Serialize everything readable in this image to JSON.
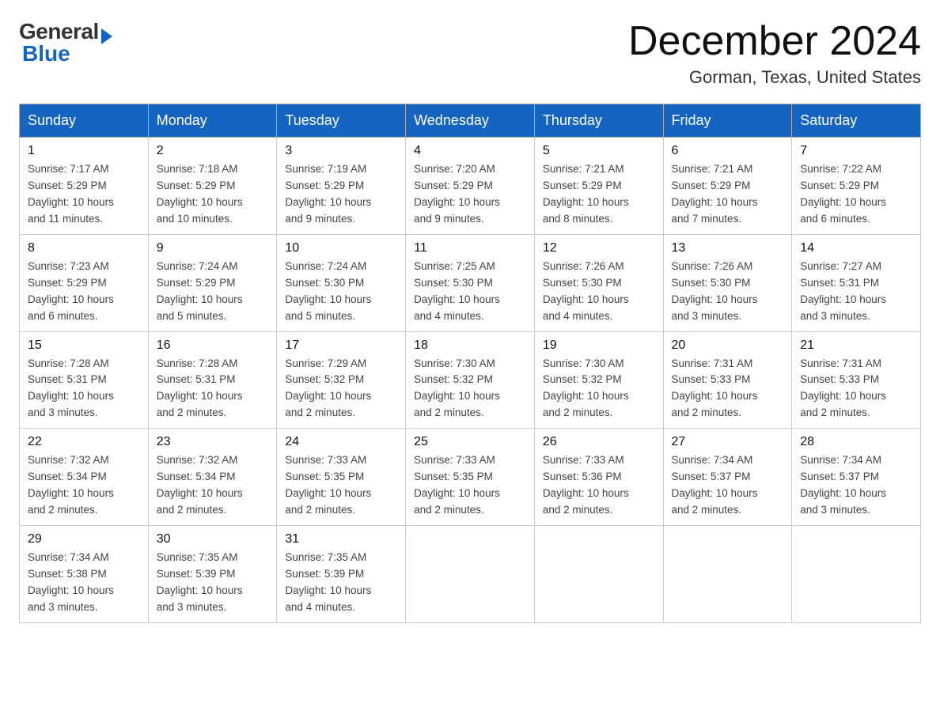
{
  "logo": {
    "general": "General",
    "blue": "Blue"
  },
  "title": {
    "month": "December 2024",
    "location": "Gorman, Texas, United States"
  },
  "headers": [
    "Sunday",
    "Monday",
    "Tuesday",
    "Wednesday",
    "Thursday",
    "Friday",
    "Saturday"
  ],
  "weeks": [
    [
      {
        "day": "1",
        "sunrise": "7:17 AM",
        "sunset": "5:29 PM",
        "daylight": "10 hours and 11 minutes."
      },
      {
        "day": "2",
        "sunrise": "7:18 AM",
        "sunset": "5:29 PM",
        "daylight": "10 hours and 10 minutes."
      },
      {
        "day": "3",
        "sunrise": "7:19 AM",
        "sunset": "5:29 PM",
        "daylight": "10 hours and 9 minutes."
      },
      {
        "day": "4",
        "sunrise": "7:20 AM",
        "sunset": "5:29 PM",
        "daylight": "10 hours and 9 minutes."
      },
      {
        "day": "5",
        "sunrise": "7:21 AM",
        "sunset": "5:29 PM",
        "daylight": "10 hours and 8 minutes."
      },
      {
        "day": "6",
        "sunrise": "7:21 AM",
        "sunset": "5:29 PM",
        "daylight": "10 hours and 7 minutes."
      },
      {
        "day": "7",
        "sunrise": "7:22 AM",
        "sunset": "5:29 PM",
        "daylight": "10 hours and 6 minutes."
      }
    ],
    [
      {
        "day": "8",
        "sunrise": "7:23 AM",
        "sunset": "5:29 PM",
        "daylight": "10 hours and 6 minutes."
      },
      {
        "day": "9",
        "sunrise": "7:24 AM",
        "sunset": "5:29 PM",
        "daylight": "10 hours and 5 minutes."
      },
      {
        "day": "10",
        "sunrise": "7:24 AM",
        "sunset": "5:30 PM",
        "daylight": "10 hours and 5 minutes."
      },
      {
        "day": "11",
        "sunrise": "7:25 AM",
        "sunset": "5:30 PM",
        "daylight": "10 hours and 4 minutes."
      },
      {
        "day": "12",
        "sunrise": "7:26 AM",
        "sunset": "5:30 PM",
        "daylight": "10 hours and 4 minutes."
      },
      {
        "day": "13",
        "sunrise": "7:26 AM",
        "sunset": "5:30 PM",
        "daylight": "10 hours and 3 minutes."
      },
      {
        "day": "14",
        "sunrise": "7:27 AM",
        "sunset": "5:31 PM",
        "daylight": "10 hours and 3 minutes."
      }
    ],
    [
      {
        "day": "15",
        "sunrise": "7:28 AM",
        "sunset": "5:31 PM",
        "daylight": "10 hours and 3 minutes."
      },
      {
        "day": "16",
        "sunrise": "7:28 AM",
        "sunset": "5:31 PM",
        "daylight": "10 hours and 2 minutes."
      },
      {
        "day": "17",
        "sunrise": "7:29 AM",
        "sunset": "5:32 PM",
        "daylight": "10 hours and 2 minutes."
      },
      {
        "day": "18",
        "sunrise": "7:30 AM",
        "sunset": "5:32 PM",
        "daylight": "10 hours and 2 minutes."
      },
      {
        "day": "19",
        "sunrise": "7:30 AM",
        "sunset": "5:32 PM",
        "daylight": "10 hours and 2 minutes."
      },
      {
        "day": "20",
        "sunrise": "7:31 AM",
        "sunset": "5:33 PM",
        "daylight": "10 hours and 2 minutes."
      },
      {
        "day": "21",
        "sunrise": "7:31 AM",
        "sunset": "5:33 PM",
        "daylight": "10 hours and 2 minutes."
      }
    ],
    [
      {
        "day": "22",
        "sunrise": "7:32 AM",
        "sunset": "5:34 PM",
        "daylight": "10 hours and 2 minutes."
      },
      {
        "day": "23",
        "sunrise": "7:32 AM",
        "sunset": "5:34 PM",
        "daylight": "10 hours and 2 minutes."
      },
      {
        "day": "24",
        "sunrise": "7:33 AM",
        "sunset": "5:35 PM",
        "daylight": "10 hours and 2 minutes."
      },
      {
        "day": "25",
        "sunrise": "7:33 AM",
        "sunset": "5:35 PM",
        "daylight": "10 hours and 2 minutes."
      },
      {
        "day": "26",
        "sunrise": "7:33 AM",
        "sunset": "5:36 PM",
        "daylight": "10 hours and 2 minutes."
      },
      {
        "day": "27",
        "sunrise": "7:34 AM",
        "sunset": "5:37 PM",
        "daylight": "10 hours and 2 minutes."
      },
      {
        "day": "28",
        "sunrise": "7:34 AM",
        "sunset": "5:37 PM",
        "daylight": "10 hours and 3 minutes."
      }
    ],
    [
      {
        "day": "29",
        "sunrise": "7:34 AM",
        "sunset": "5:38 PM",
        "daylight": "10 hours and 3 minutes."
      },
      {
        "day": "30",
        "sunrise": "7:35 AM",
        "sunset": "5:39 PM",
        "daylight": "10 hours and 3 minutes."
      },
      {
        "day": "31",
        "sunrise": "7:35 AM",
        "sunset": "5:39 PM",
        "daylight": "10 hours and 4 minutes."
      },
      null,
      null,
      null,
      null
    ]
  ]
}
